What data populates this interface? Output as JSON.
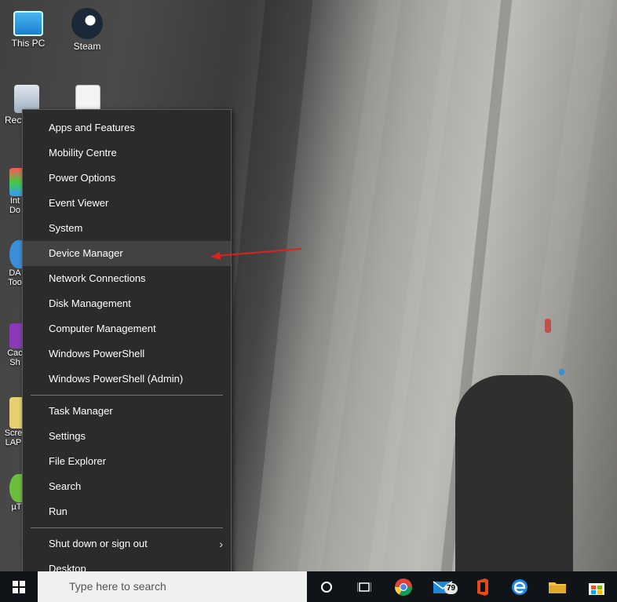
{
  "desktop_icons": [
    {
      "label": "This PC"
    },
    {
      "label": "Steam"
    },
    {
      "label": "Recy"
    },
    {
      "label": "Int Do"
    },
    {
      "label": "DA Too"
    },
    {
      "label": "Cac Sh"
    },
    {
      "label": "Scre LAP"
    },
    {
      "label": "µT"
    }
  ],
  "menu": {
    "group1": [
      "Apps and Features",
      "Mobility Centre",
      "Power Options",
      "Event Viewer",
      "System",
      "Device Manager",
      "Network Connections",
      "Disk Management",
      "Computer Management",
      "Windows PowerShell",
      "Windows PowerShell (Admin)"
    ],
    "group2": [
      "Task Manager",
      "Settings",
      "File Explorer",
      "Search",
      "Run"
    ],
    "group3": [
      "Shut down or sign out",
      "Desktop"
    ],
    "highlighted": "Device Manager"
  },
  "taskbar": {
    "search_placeholder": "Type here to search",
    "mail_badge": "79"
  },
  "colors": {
    "arrow": "#e0201e",
    "menu_bg": "#2b2b2b",
    "taskbar_bg": "#101418"
  }
}
